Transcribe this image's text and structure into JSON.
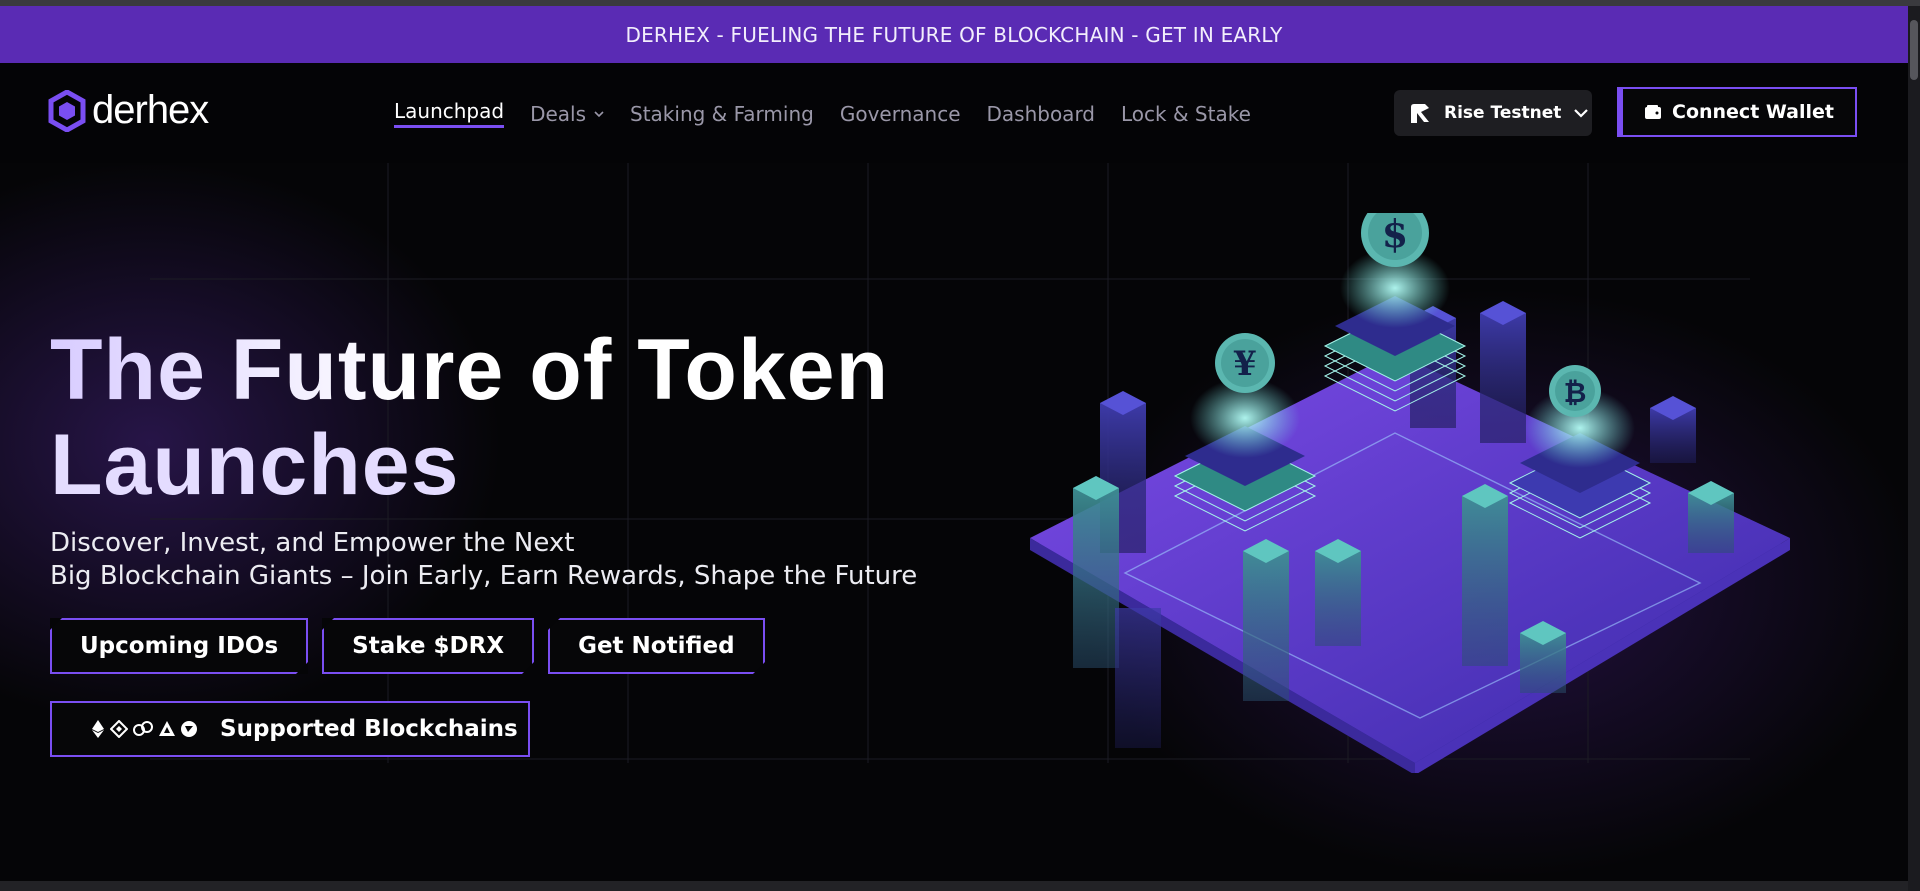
{
  "announcement": "DERHEX - FUELING THE FUTURE OF BLOCKCHAIN - GET IN EARLY",
  "brand": {
    "name": "derhex",
    "accent": "#7a4ef2",
    "banner_color": "#5a2bb4"
  },
  "nav": {
    "items": [
      {
        "label": "Launchpad",
        "active": true
      },
      {
        "label": "Deals",
        "dropdown": true
      },
      {
        "label": "Staking & Farming"
      },
      {
        "label": "Governance"
      },
      {
        "label": "Dashboard"
      },
      {
        "label": "Lock & Stake"
      }
    ],
    "network": {
      "label": "Rise Testnet",
      "icon": "rise-logo-icon"
    },
    "connect_wallet": {
      "label": "Connect Wallet",
      "icon": "wallet-icon"
    }
  },
  "hero": {
    "title_line1": "The Future of Token",
    "title_line2": "Launches",
    "subtitle_line1": "Discover, Invest, and Empower the Next",
    "subtitle_line2": "Big Blockchain Giants – Join Early, Earn Rewards, Shape the Future",
    "buttons": [
      {
        "label": "Upcoming IDOs"
      },
      {
        "label": "Stake $DRX"
      },
      {
        "label": "Get Notified"
      }
    ],
    "supported_chains": {
      "label": "Supported Blockchains",
      "icons": [
        "ethereum-icon",
        "bnb-icon",
        "chain-link-icon",
        "arbitrum-icon",
        "celo-icon"
      ]
    },
    "illustration": {
      "coins": [
        "$",
        "¥",
        "₿"
      ]
    }
  }
}
